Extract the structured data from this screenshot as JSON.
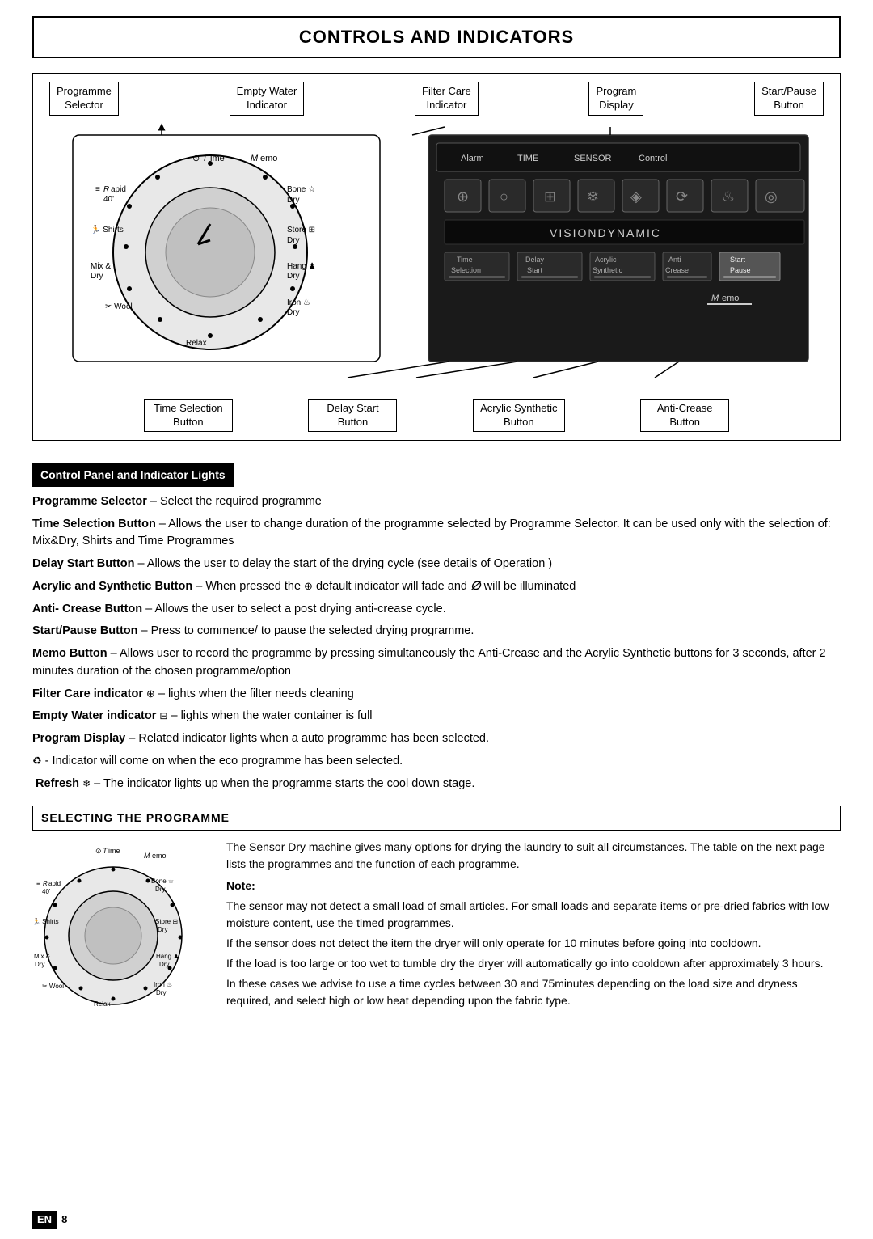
{
  "page": {
    "title": "CONTROLS AND INDICATORS",
    "footer_lang": "EN",
    "footer_page": "8"
  },
  "top_labels": [
    {
      "id": "programme-selector-label",
      "text": "Programme\nSelector"
    },
    {
      "id": "empty-water-indicator-label",
      "text": "Empty Water\nIndicator"
    },
    {
      "id": "filter-care-indicator-label",
      "text": "Filter Care\nIndicator"
    },
    {
      "id": "program-display-label",
      "text": "Program\nDisplay"
    },
    {
      "id": "start-pause-button-label",
      "text": "Start/Pause\nButton"
    }
  ],
  "bottom_labels": [
    {
      "id": "time-selection-button-label",
      "text": "Time Selection\nButton"
    },
    {
      "id": "delay-start-button-label",
      "text": "Delay Start\nButton"
    },
    {
      "id": "acrylic-synthetic-button-label",
      "text": "Acrylic Synthetic\nButton"
    },
    {
      "id": "anti-crease-button-label",
      "text": "Anti-Crease\nButton"
    }
  ],
  "section1_header": "Control Panel and Indicator Lights",
  "descriptions": [
    {
      "id": "desc-programme-selector",
      "bold_part": "Programme Selector",
      "separator": " – ",
      "normal_part": "Select the required programme"
    },
    {
      "id": "desc-time-selection",
      "bold_part": "Time Selection Button",
      "separator": " – ",
      "normal_part": "Allows the user to change duration of the programme selected by Programme Selector. It can be used only with the selection of: Mix&Dry, Shirts and Time Programmes"
    },
    {
      "id": "desc-delay-start",
      "bold_part": "Delay Start Button",
      "separator": "  – ",
      "normal_part": "Allows the user to delay the start of the drying cycle (see details of Operation )"
    },
    {
      "id": "desc-acrylic",
      "bold_part": "Acrylic and Synthetic Button",
      "separator": "  – ",
      "normal_part": "When pressed the  default indicator will fade and  will be illuminated",
      "has_icons": true
    },
    {
      "id": "desc-anti-crease",
      "bold_part": "Anti- Crease Button",
      "separator": " – ",
      "normal_part": " Allows the user to select  a post drying anti-crease cycle."
    },
    {
      "id": "desc-start-pause",
      "bold_part": "Start/Pause Button",
      "separator": " – ",
      "normal_part": "Press to commence/ to pause the selected drying programme."
    },
    {
      "id": "desc-memo",
      "bold_part": "Memo Button",
      "separator": "  – ",
      "normal_part": "Allows user to record the programme  by pressing simultaneously the Anti-Crease and the Acrylic Synthetic buttons for 3 seconds, after 2 minutes duration of  the chosen programme/option"
    },
    {
      "id": "desc-filter-care",
      "bold_part": "Filter Care indicator",
      "separator": " ",
      "normal_part": " – lights when the filter needs cleaning",
      "has_icon": true
    },
    {
      "id": "desc-empty-water",
      "bold_part": "Empty Water indicator",
      "separator": " ",
      "normal_part": " – lights when the water container is full",
      "has_icon": true
    },
    {
      "id": "desc-program-display",
      "bold_part": "Program Display",
      "separator": "  – ",
      "normal_part": "Related indicator lights when a auto programme has been selected."
    },
    {
      "id": "desc-eco",
      "bold_part": "",
      "separator": "",
      "normal_part": "  - Indicator will come on  when the eco programme has been selected."
    },
    {
      "id": "desc-refresh",
      "bold_part": "Refresh",
      "separator": "  – ",
      "normal_part": "The indicator lights up when the programme starts the cool down stage."
    }
  ],
  "section2_header": "SELECTING THE  PROGRAMME",
  "bottom_text_parts": [
    {
      "id": "bottom-p1",
      "text": "The Sensor Dry machine gives many options for drying the laundry to suit all circumstances. The table on the next page lists the programmes and the function of each programme."
    },
    {
      "id": "bottom-note-label",
      "text": "Note:"
    },
    {
      "id": "bottom-p2",
      "text": "The sensor may not detect a small load of small articles. For small loads and separate items or pre-dried fabrics with low moisture content, use the timed programmes."
    },
    {
      "id": "bottom-p3",
      "text": "If the sensor does not detect the item the dryer will only operate for 10 minutes before going into cooldown."
    },
    {
      "id": "bottom-p4",
      "text": "If the load is too large or too wet to tumble dry the dryer will automatically go into cooldown after approximately 3 hours."
    },
    {
      "id": "bottom-p5",
      "text": "In these cases we advise to use a time cycles between 30 and 75minutes depending on the load size and dryness required, and select high or low heat depending upon the fabric type."
    }
  ],
  "dial_labels": {
    "time": "Time",
    "memo": "Memo",
    "rapid40": "Rapid\n40'",
    "shirts": "Shirts",
    "mix_dry": "Mix &\nDry",
    "wool": "Wool",
    "relax": "Relax",
    "iron_dry": "Iron\nDry",
    "hang_dry": "Hang\nDry",
    "store_dry": "Store\nDry",
    "bone_dry": "Bone\nDry"
  }
}
